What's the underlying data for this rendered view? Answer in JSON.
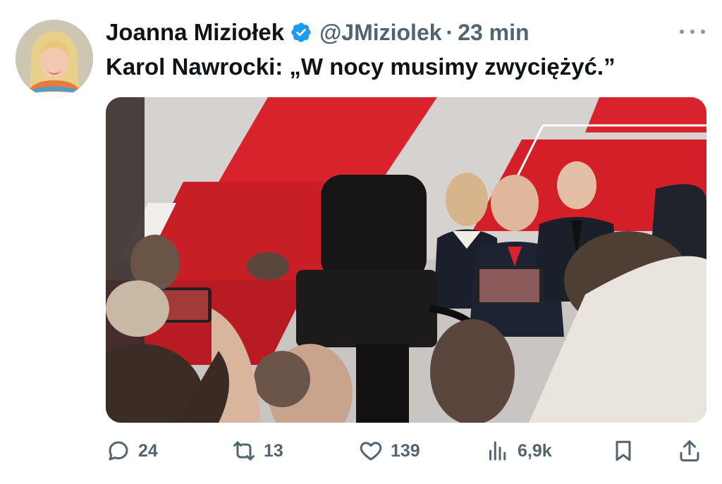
{
  "tweet": {
    "author_name": "Joanna Miziołek",
    "handle": "@JMiziolek",
    "separator": "·",
    "time_ago": "23 min",
    "text": "Karol Nawrocki: „W nocy musimy zwyciężyć.”"
  },
  "media": {
    "icon": "photo"
  },
  "actions": {
    "reply_count": "24",
    "retweet_count": "13",
    "like_count": "139",
    "views_count": "6,9k"
  },
  "icons": {
    "verified": "verified-badge-icon",
    "more": "more-icon",
    "reply": "reply-icon",
    "retweet": "retweet-icon",
    "like": "heart-icon",
    "views": "views-icon",
    "bookmark": "bookmark-icon",
    "share": "share-icon"
  },
  "colors": {
    "verified_blue": "#1d9bf0",
    "muted_text": "#536471",
    "primary_text": "#0f1419",
    "stage_red": "#d8222c"
  }
}
